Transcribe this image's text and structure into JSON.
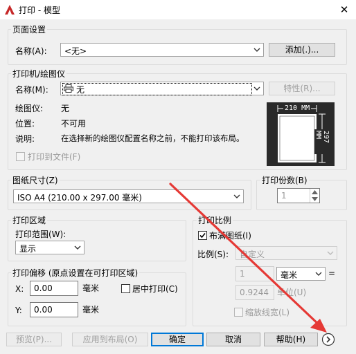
{
  "window": {
    "title": "打印 - 模型",
    "close_icon": "close-icon"
  },
  "page_setup": {
    "group_label": "页面设置",
    "name_label": "名称(A):",
    "name_value": "<无>",
    "add_button": "添加(.)..."
  },
  "printer": {
    "group_label": "打印机/绘图仪",
    "name_label": "名称(M):",
    "name_value": "无",
    "properties_button": "特性(R)...",
    "plotter_label": "绘图仪:",
    "plotter_value": "无",
    "location_label": "位置:",
    "location_value": "不可用",
    "description_label": "说明:",
    "description_value": "在选择新的绘图仪配置名称之前，不能打印该布局。",
    "print_to_file_label": "打印到文件(F)",
    "preview": {
      "width_text": "210 MM",
      "height_text": "297 MM"
    }
  },
  "paper_size": {
    "group_label": "图纸尺寸(Z)",
    "value": "ISO A4 (210.00 x 297.00 毫米)"
  },
  "copies": {
    "group_label": "打印份数(B)",
    "value": "1"
  },
  "plot_area": {
    "group_label": "打印区域",
    "range_label": "打印范围(W):",
    "range_value": "显示"
  },
  "plot_offset": {
    "group_label": "打印偏移 (原点设置在可打印区域)",
    "x_label": "X:",
    "x_value": "0.00",
    "x_unit": "毫米",
    "y_label": "Y:",
    "y_value": "0.00",
    "y_unit": "毫米",
    "center_label": "居中打印(C)"
  },
  "plot_scale": {
    "group_label": "打印比例",
    "fit_label": "布满图纸(I)",
    "scale_label": "比例(S):",
    "scale_value": "自定义",
    "value1": "1",
    "unit_value": "毫米",
    "equals": "=",
    "value2": "0.9244",
    "unit2_label": "单位(U)",
    "lineweight_label": "缩放线宽(L)"
  },
  "footer": {
    "preview_button": "预览(P)...",
    "apply_button": "应用到布局(O)",
    "ok_button": "确定",
    "cancel_button": "取消",
    "help_button": "帮助(H)",
    "more_icon": "chevron-right-icon"
  },
  "colors": {
    "annotation_arrow": "#e53935",
    "accent": "#0078d7"
  }
}
